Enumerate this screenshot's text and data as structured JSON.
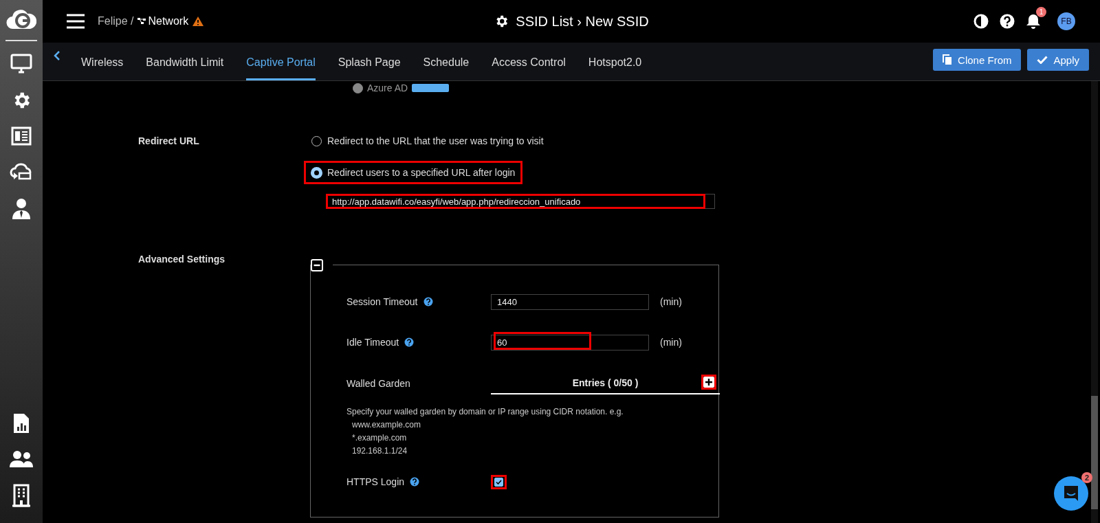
{
  "header": {
    "org": "Felipe /",
    "network": "Network",
    "title": "SSID List › New SSID",
    "notification_count": "1",
    "avatar": "FB"
  },
  "tabs": [
    {
      "label": "Wireless",
      "selected": false
    },
    {
      "label": "Bandwidth Limit",
      "selected": false
    },
    {
      "label": "Captive Portal",
      "selected": true
    },
    {
      "label": "Splash Page",
      "selected": false
    },
    {
      "label": "Schedule",
      "selected": false
    },
    {
      "label": "Access Control",
      "selected": false
    },
    {
      "label": "Hotspot2.0",
      "selected": false
    }
  ],
  "actions": [
    {
      "kind": "clone",
      "label": "Clone From"
    },
    {
      "kind": "apply",
      "label": "Apply"
    }
  ],
  "auth_option": {
    "label": "Azure AD",
    "selected": false
  },
  "redirect": {
    "label": "Redirect URL",
    "options": [
      {
        "label": "Redirect to the URL that the user was trying to visit",
        "selected": false,
        "highlighted": false
      },
      {
        "label": "Redirect users to a specified URL after login",
        "selected": true,
        "highlighted": true
      }
    ],
    "url": {
      "value": "http://app.datawifi.co/easyfi/web/app.php/redireccion_unificado",
      "highlighted": true
    }
  },
  "advanced": {
    "label": "Advanced Settings",
    "expanded": true,
    "fields": [
      {
        "kind": "number",
        "label": "Session Timeout",
        "help": true,
        "value": "1440",
        "unit": "(min)",
        "highlighted": false
      },
      {
        "kind": "number",
        "label": "Idle Timeout",
        "help": true,
        "value": "60",
        "unit": "(min)",
        "highlighted": true
      },
      {
        "kind": "list",
        "label": "Walled Garden",
        "help": false,
        "header": "Entries ( 0/50 )",
        "highlighted": true,
        "hint": "Specify your walled garden by domain or IP range using CIDR notation. e.g.",
        "examples": [
          "www.example.com",
          "*.example.com",
          "192.168.1.1/24"
        ]
      },
      {
        "kind": "checkbox",
        "label": "HTTPS Login",
        "help": true,
        "checked": true,
        "highlighted": true
      }
    ]
  },
  "chat": {
    "badge": "2"
  }
}
